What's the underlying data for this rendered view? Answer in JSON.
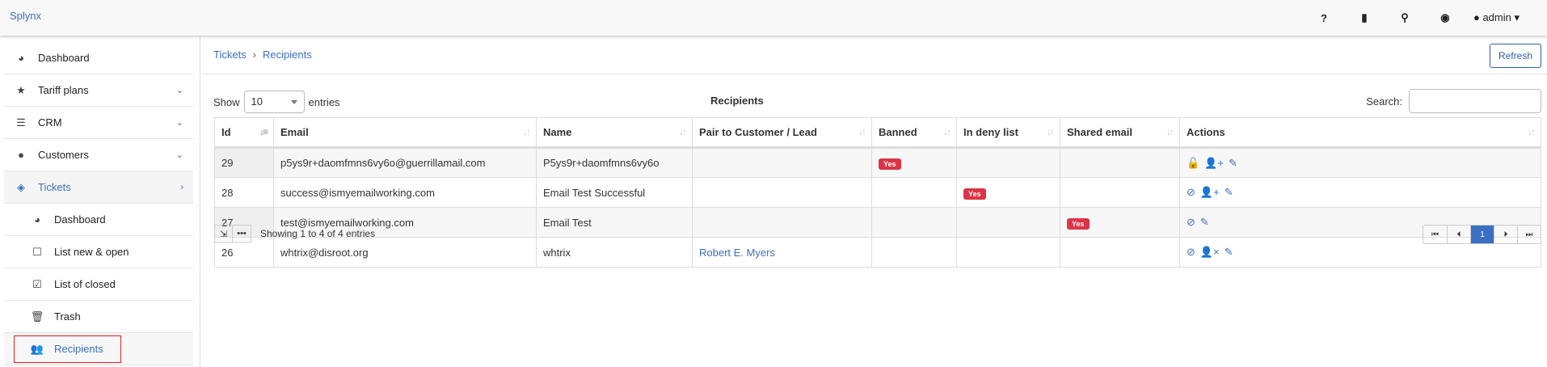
{
  "app": {
    "brand": "Splynx",
    "user": "admin"
  },
  "sidebar": {
    "items": [
      {
        "label": "Dashboard",
        "icon": "tachometer-icon"
      },
      {
        "label": "Tariff plans",
        "icon": "star-icon"
      },
      {
        "label": "CRM",
        "icon": "list-icon"
      },
      {
        "label": "Customers",
        "icon": "user-icon"
      },
      {
        "label": "Tickets",
        "icon": "ticket-icon"
      },
      {
        "label": "Dashboard",
        "icon": "tachometer-icon"
      },
      {
        "label": "List new & open",
        "icon": "square-icon"
      },
      {
        "label": "List of closed",
        "icon": "check-square-icon"
      },
      {
        "label": "Trash",
        "icon": "trash-icon"
      },
      {
        "label": "Recipients",
        "icon": "users-icon"
      }
    ]
  },
  "breadcrumb": {
    "parent": "Tickets",
    "current": "Recipients"
  },
  "refresh_label": "Refresh",
  "table": {
    "show_label": "Show",
    "page_size": "10",
    "entries_label": "entries",
    "title": "Recipients",
    "search_label": "Search:",
    "search_value": "",
    "columns": [
      "Id",
      "Email",
      "Name",
      "Pair to Customer / Lead",
      "Banned",
      "In deny list",
      "Shared email",
      "Actions"
    ],
    "rows": [
      {
        "id": "29",
        "email": "p5ys9r+daomfmns6vy6o@guerrillamail.com",
        "name": "P5ys9r+daomfmns6vy6o",
        "pair": "",
        "banned": "Yes",
        "deny": "",
        "shared": ""
      },
      {
        "id": "28",
        "email": "success@ismyemailworking.com",
        "name": "Email Test Successful",
        "pair": "",
        "banned": "",
        "deny": "Yes",
        "shared": ""
      },
      {
        "id": "27",
        "email": "test@ismyemailworking.com",
        "name": "Email Test",
        "pair": "",
        "banned": "",
        "deny": "",
        "shared": "Yes"
      },
      {
        "id": "26",
        "email": "whtrix@disroot.org",
        "name": "whtrix",
        "pair": "Robert E. Myers",
        "banned": "",
        "deny": "",
        "shared": ""
      }
    ],
    "info": "Showing 1 to 4 of 4 entries",
    "current_page": "1"
  },
  "colors": {
    "accent": "#3a6fc4",
    "danger": "#dc3545"
  }
}
